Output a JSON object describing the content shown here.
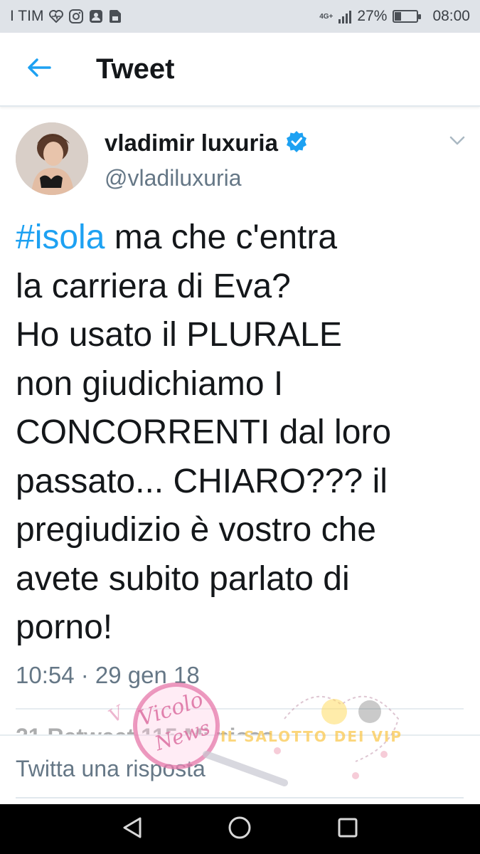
{
  "status_bar": {
    "carrier": "I TIM",
    "battery": "27%",
    "time": "08:00",
    "network": "4G+",
    "battery_level": 0.27
  },
  "header": {
    "back_icon": "arrow-left-icon",
    "title": "Tweet"
  },
  "tweet": {
    "name": "vladimir luxuria",
    "verified_icon": "verified-badge-icon",
    "handle": "@vladiluxuria",
    "hashtag": "#isola",
    "text_lines": [
      " ma che c'entra",
      "la carriera di Eva?",
      "Ho usato il PLURALE",
      "non giudichiamo I",
      "CONCORRENTI dal loro",
      "passato... CHIARO??? il",
      "pregiudizio è vostro che",
      "avete subito parlato di",
      "porno!"
    ],
    "timestamp": "10:54 · 29 gen 18",
    "stats_partial": "21 Retweet   115 Mi piace"
  },
  "reply": {
    "placeholder": "Twitta una risposta"
  },
  "watermark": {
    "text1": "Vicolo delle News",
    "text2": "Il salotto dei vip"
  },
  "colors": {
    "accent": "#1da1f2",
    "text": "#14171a",
    "secondary": "#657786",
    "status_bar_bg": "#dfe3e8",
    "nav_bg": "#000000"
  }
}
